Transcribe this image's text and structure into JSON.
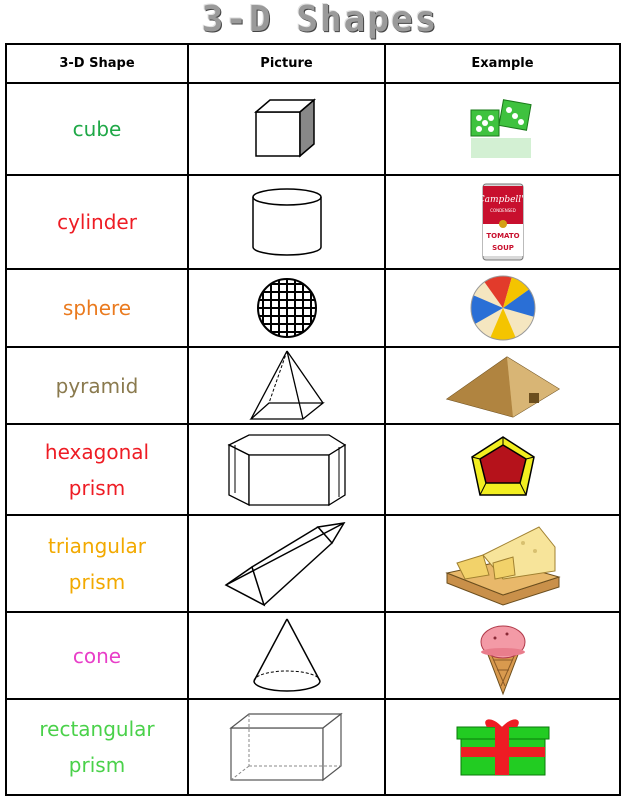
{
  "title": "3-D Shapes",
  "headers": {
    "shape": "3-D Shape",
    "picture": "Picture",
    "example": "Example"
  },
  "rows": [
    {
      "line1": "cube",
      "line2": "",
      "color": "#1fa847"
    },
    {
      "line1": "cylinder",
      "line2": "",
      "color": "#ee1c24"
    },
    {
      "line1": "sphere",
      "line2": "",
      "color": "#ea7a1e"
    },
    {
      "line1": "pyramid",
      "line2": "",
      "color": "#8a7a4e"
    },
    {
      "line1": "hexagonal",
      "line2": "prism",
      "color": "#ee1c24"
    },
    {
      "line1": "triangular",
      "line2": "prism",
      "color": "#f2a900"
    },
    {
      "line1": "cone",
      "line2": "",
      "color": "#e83ec8"
    },
    {
      "line1": "rectangular",
      "line2": "prism",
      "color": "#4ad14a"
    }
  ],
  "examples": [
    "dice-icon",
    "soup-can-icon",
    "beach-ball-icon",
    "sand-pyramid-icon",
    "pentagon-box-icon",
    "cheese-icon",
    "ice-cream-cone-icon",
    "gift-box-icon"
  ],
  "can_label": {
    "brand": "Campbell's",
    "sub": "CONDENSED",
    "flavor": "TOMATO",
    "type": "SOUP"
  }
}
